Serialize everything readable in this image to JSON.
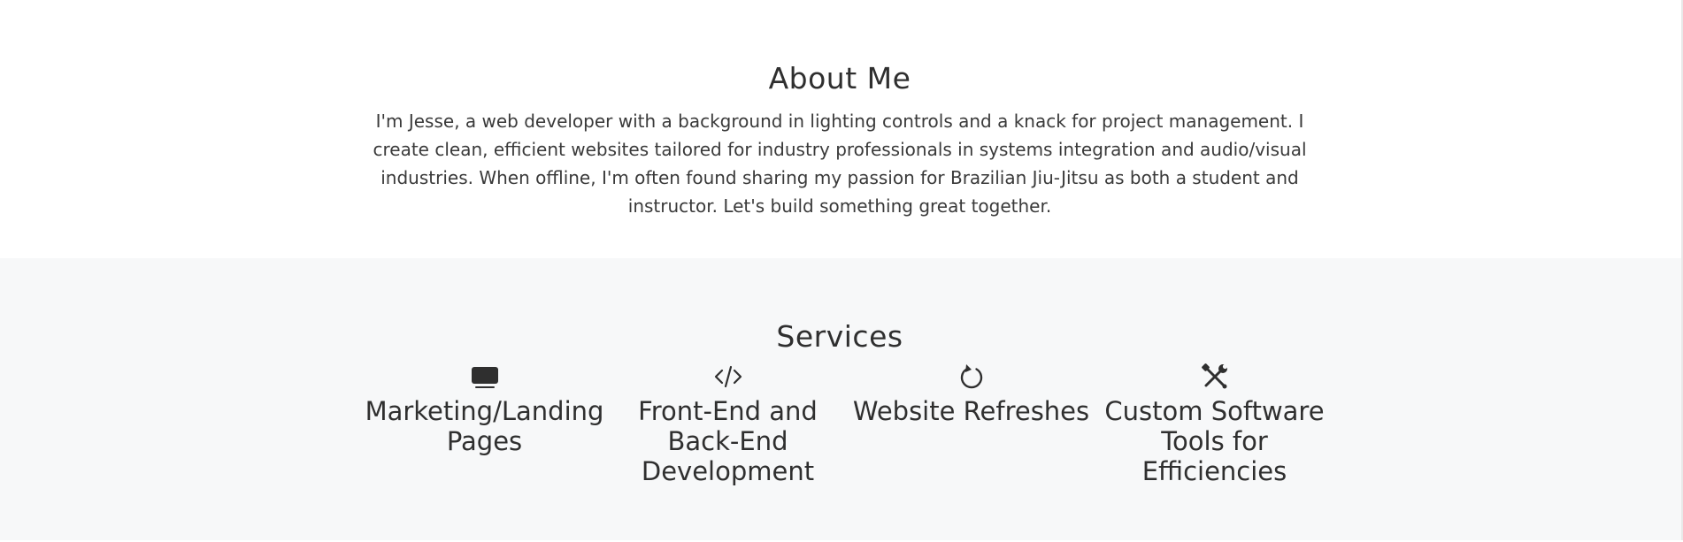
{
  "about": {
    "title": "About Me",
    "text": "I'm Jesse, a web developer with a background in lighting controls and a knack for project management. I create clean, efficient websites tailored for industry professionals in systems integration and audio/visual industries. When offline, I'm often found sharing my passion for Brazilian Jiu-Jitsu as both a student and instructor. Let's build something great together."
  },
  "services": {
    "title": "Services",
    "items": [
      {
        "icon": "monitor-icon",
        "label": "Marketing/Landing Pages"
      },
      {
        "icon": "code-icon",
        "label": "Front-End and Back-End Development"
      },
      {
        "icon": "refresh-icon",
        "label": "Website Refreshes"
      },
      {
        "icon": "tools-icon",
        "label": "Custom Software Tools for Efficiencies"
      }
    ]
  },
  "colors": {
    "text": "#2f2f2f",
    "services_background": "#f7f8f9",
    "about_background": "#ffffff"
  }
}
